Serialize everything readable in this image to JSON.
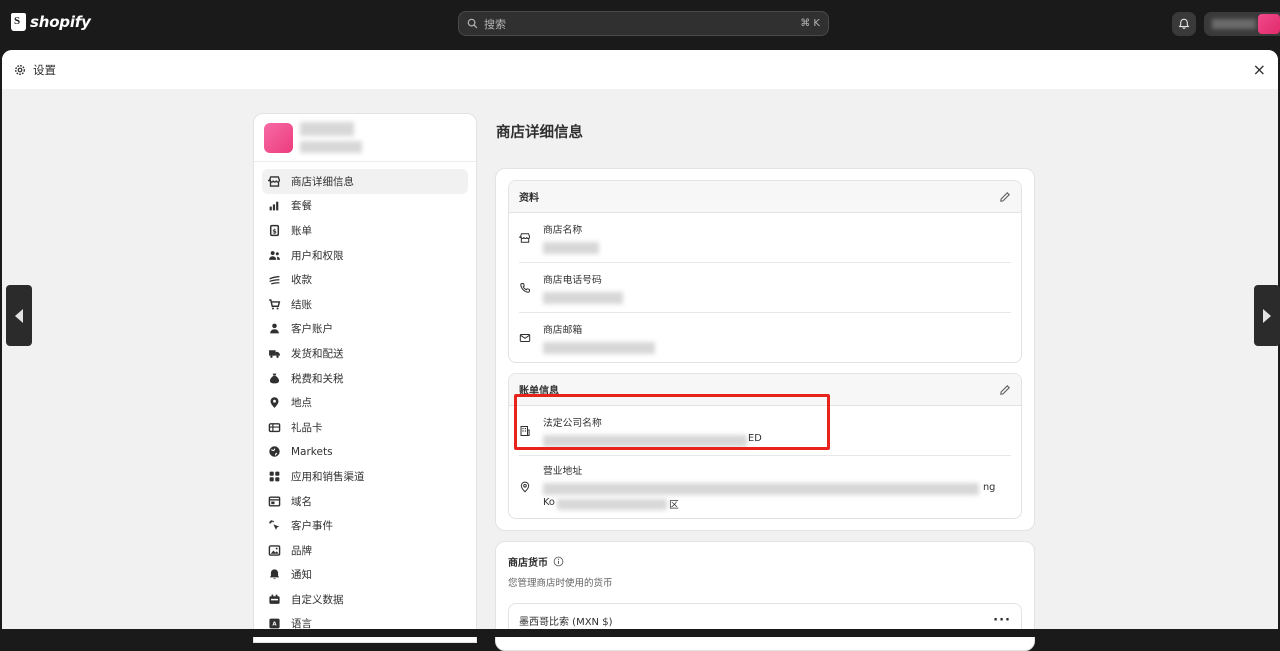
{
  "topbar": {
    "brand": "shopify",
    "search_placeholder": "搜索",
    "search_shortcut": "⌘ K"
  },
  "modal": {
    "title": "设置",
    "close_label": "×"
  },
  "sidebar": {
    "items": [
      {
        "label": "商店详细信息",
        "icon": "store-icon",
        "active": true
      },
      {
        "label": "套餐",
        "icon": "plan-chart-icon"
      },
      {
        "label": "账单",
        "icon": "billing-icon"
      },
      {
        "label": "用户和权限",
        "icon": "users-icon"
      },
      {
        "label": "收款",
        "icon": "payments-icon"
      },
      {
        "label": "结账",
        "icon": "cart-icon"
      },
      {
        "label": "客户账户",
        "icon": "person-icon"
      },
      {
        "label": "发货和配送",
        "icon": "truck-icon"
      },
      {
        "label": "税费和关税",
        "icon": "money-bag-icon"
      },
      {
        "label": "地点",
        "icon": "location-pin-icon"
      },
      {
        "label": "礼品卡",
        "icon": "gift-card-icon"
      },
      {
        "label": "Markets",
        "icon": "globe-icon"
      },
      {
        "label": "应用和销售渠道",
        "icon": "apps-icon"
      },
      {
        "label": "域名",
        "icon": "domain-icon"
      },
      {
        "label": "客户事件",
        "icon": "cursor-sparkle-icon"
      },
      {
        "label": "品牌",
        "icon": "brand-image-icon"
      },
      {
        "label": "通知",
        "icon": "bell-icon"
      },
      {
        "label": "自定义数据",
        "icon": "custom-data-icon"
      },
      {
        "label": "语言",
        "icon": "language-icon"
      }
    ]
  },
  "main": {
    "page_title": "商店详细信息",
    "profile": {
      "heading": "资料",
      "rows": [
        {
          "label": "商店名称",
          "icon": "store-icon"
        },
        {
          "label": "商店电话号码",
          "icon": "phone-icon"
        },
        {
          "label": "商店邮箱",
          "icon": "email-icon"
        }
      ]
    },
    "billing": {
      "heading": "账单信息",
      "rows": [
        {
          "label": "法定公司名称",
          "icon": "building-icon",
          "value_tail": "ED"
        },
        {
          "label": "营业地址",
          "icon": "location-pin-icon",
          "value_line2_start": "Ko",
          "value_line2_end": "区",
          "value_line1_end": "ng"
        }
      ]
    },
    "currency": {
      "title": "商店货币",
      "subtitle": "您管理商店时使用的货币",
      "value": "墨西哥比索 (MXN $)"
    }
  }
}
